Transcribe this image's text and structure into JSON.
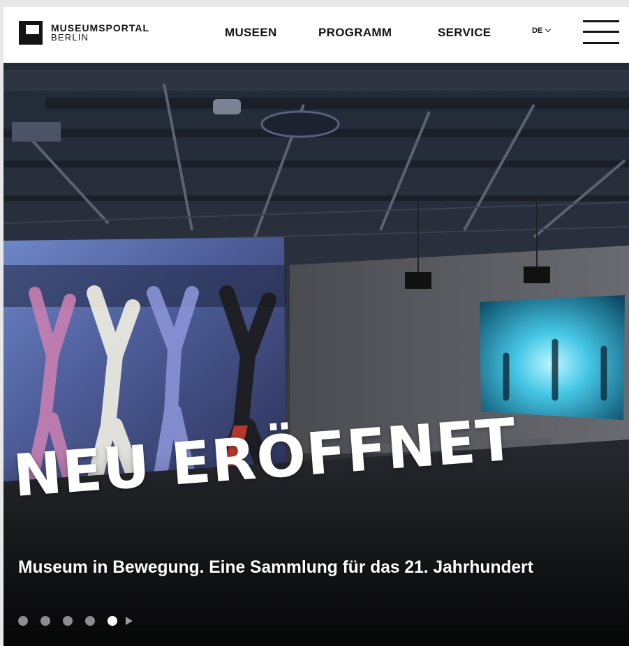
{
  "brand": {
    "name_line1": "MUSEUMSPORTAL",
    "name_line2": "BERLIN"
  },
  "nav": {
    "items": [
      "MUSEEN",
      "PROGRAMM",
      "SERVICE"
    ]
  },
  "language": {
    "current": "DE"
  },
  "hero": {
    "headline": "NEU ERÖFFNET",
    "subtitle": "Museum in Bewegung. Eine Sammlung für das 21. Jahrhundert",
    "slider": {
      "total": 5,
      "active_index": 4
    }
  },
  "icons": [
    "logo-mark-icon",
    "chevron-down-icon",
    "hamburger-menu-icon",
    "play-icon"
  ],
  "colors": {
    "text_dark": "#141414",
    "header_bg": "#ffffff",
    "dot_inactive": "#8d8d8d",
    "dot_active": "#ffffff"
  }
}
